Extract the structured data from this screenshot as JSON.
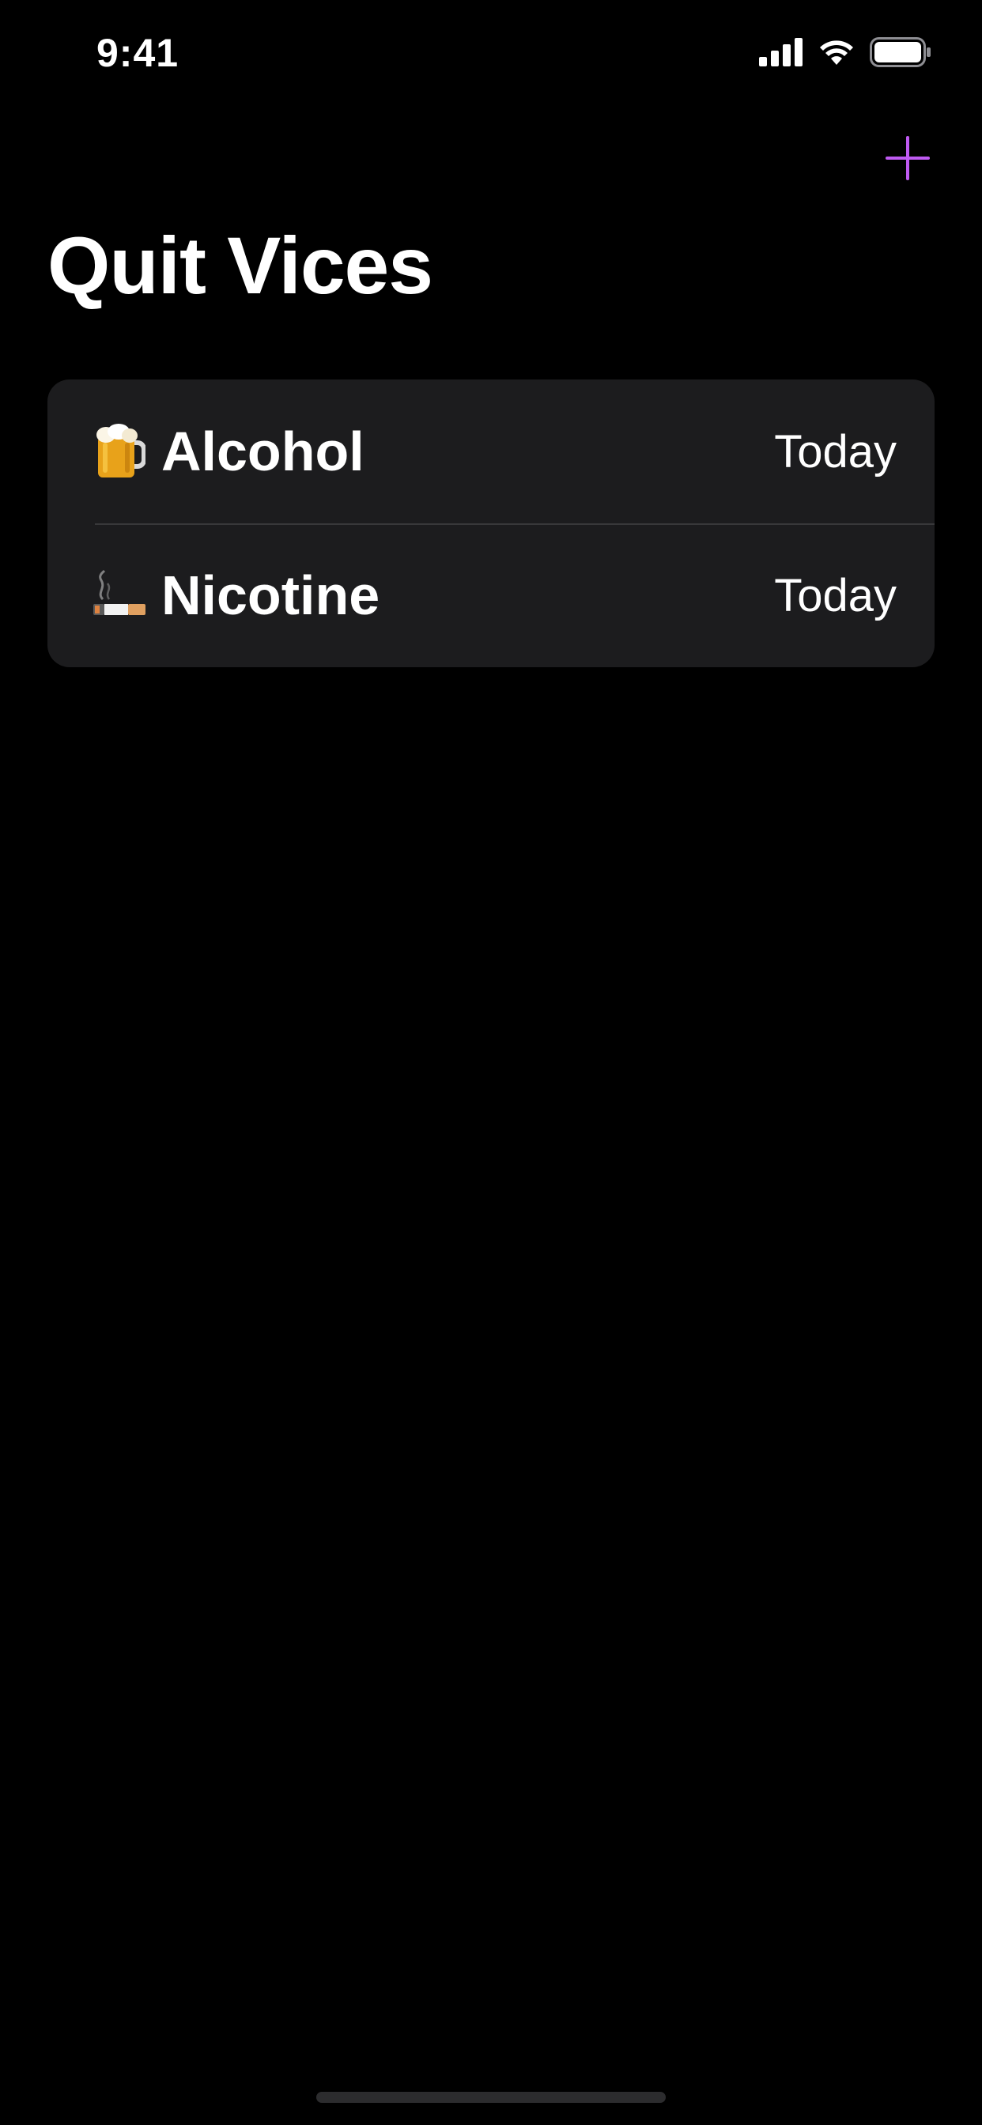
{
  "status_bar": {
    "time": "9:41"
  },
  "nav": {
    "add_icon": "plus-icon",
    "accent_color": "#bf5af2"
  },
  "title": "Quit Vices",
  "vices": [
    {
      "icon": "beer-mug-icon",
      "name": "Alcohol",
      "date": "Today"
    },
    {
      "icon": "cigarette-icon",
      "name": "Nicotine",
      "date": "Today"
    }
  ]
}
